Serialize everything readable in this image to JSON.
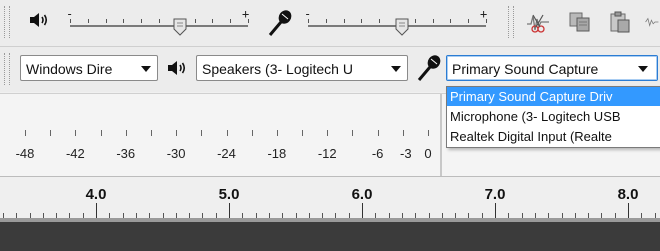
{
  "mixer": {
    "output_slider": {
      "min_label": "-",
      "max_label": "+",
      "level": 0.62
    },
    "input_slider": {
      "min_label": "-",
      "max_label": "+",
      "level": 0.53
    }
  },
  "device_bar": {
    "host": {
      "value": "Windows Dire"
    },
    "playback_device": {
      "value": "Speakers (3- Logitech U"
    },
    "recording_device": {
      "value": "Primary Sound Capture",
      "options": [
        "Primary Sound Capture Driv",
        "Microphone (3- Logitech USB",
        "Realtek Digital Input (Realte"
      ],
      "highlighted_index": 0
    }
  },
  "meter": {
    "labels": [
      "-48",
      "-42",
      "-36",
      "-30",
      "-24",
      "-18",
      "-12",
      "-6",
      "-3",
      "0"
    ]
  },
  "timeline": {
    "labels": [
      "4.0",
      "5.0",
      "6.0",
      "7.0",
      "8.0"
    ]
  },
  "colors": {
    "selection": "#3399ff",
    "focus_border": "#2b7cd3",
    "track_background": "#3b3b3b"
  },
  "icons": {
    "output_volume": "speaker-icon",
    "input_volume": "microphone-icon",
    "trim": "trim-audio-icon",
    "silence": "silence-audio-icon",
    "copy": "copy-icon",
    "paste": "paste-icon"
  }
}
